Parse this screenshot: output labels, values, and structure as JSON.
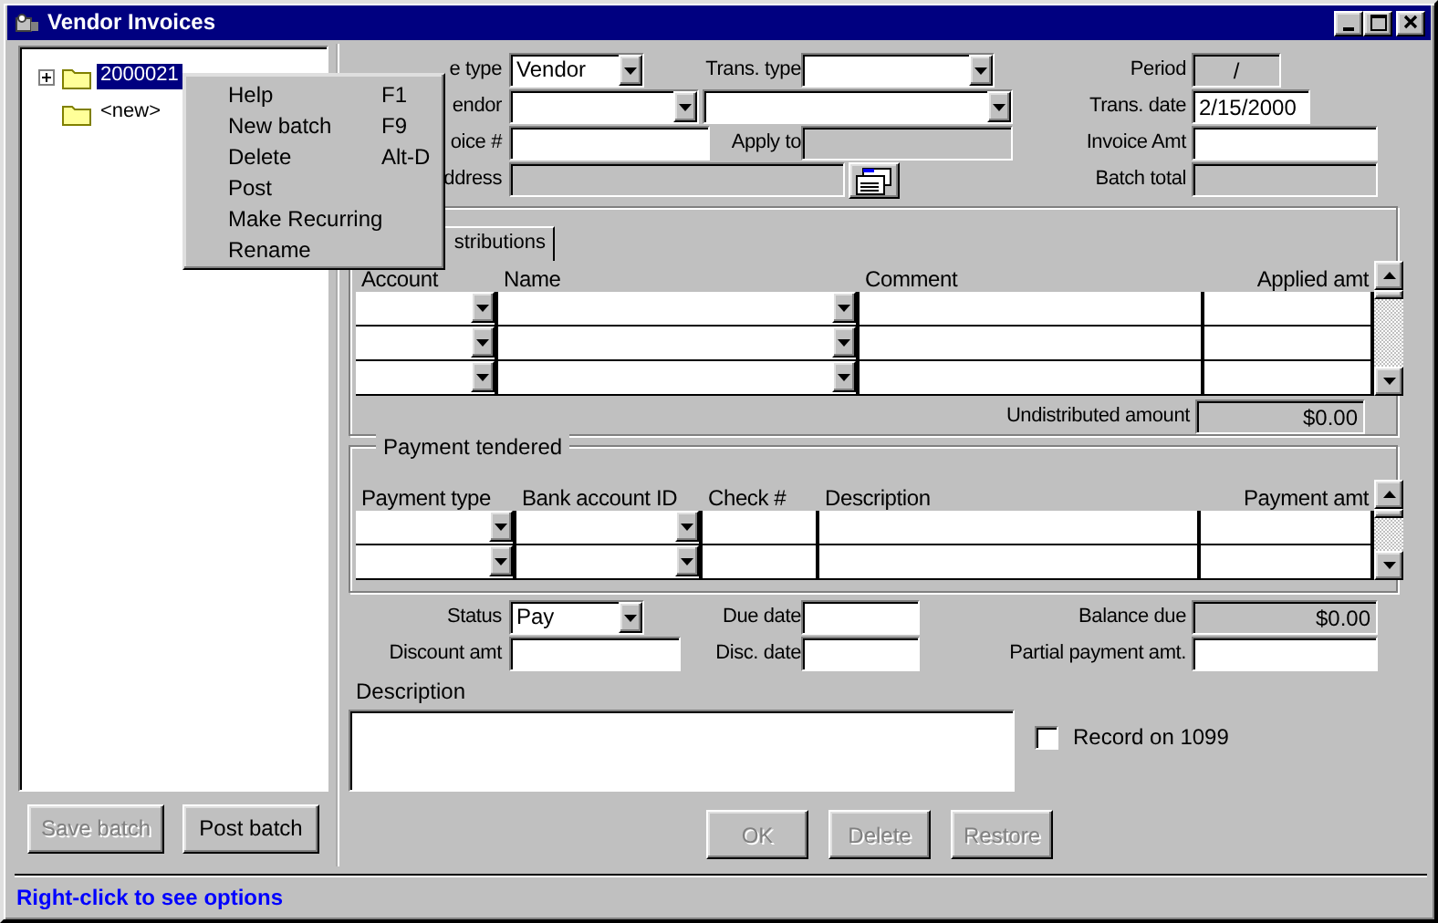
{
  "window": {
    "title": "Vendor Invoices"
  },
  "tree": [
    {
      "label": "2000021",
      "kind": "collapsed",
      "selected": true
    },
    {
      "label": "<new>",
      "kind": "leaf",
      "selected": false
    }
  ],
  "context_menu": [
    {
      "label": "Help",
      "shortcut": "F1"
    },
    {
      "label": "New batch",
      "shortcut": "F9"
    },
    {
      "label": "Delete",
      "shortcut": "Alt-D"
    },
    {
      "label": "Post"
    },
    {
      "label": "Make Recurring"
    },
    {
      "label": "Rename"
    }
  ],
  "batch_buttons": [
    {
      "label": "Save batch",
      "disabled": true
    },
    {
      "label": "Post batch",
      "disabled": false
    }
  ],
  "header_rows": [
    [
      {
        "label": "e type",
        "kind": "combo",
        "value": "Vendor"
      },
      {
        "label": "Trans. type",
        "kind": "combo"
      },
      {
        "label": "Period",
        "kind": "readonly",
        "value": "/"
      }
    ],
    [
      {
        "label": "endor",
        "kind": "combo"
      },
      {
        "kind": "combo"
      },
      {
        "label": "Trans. date",
        "kind": "text",
        "value": "2/15/2000"
      }
    ],
    [
      {
        "label": "oice #",
        "kind": "text"
      },
      {
        "label": "Apply to",
        "kind": "readonly"
      },
      {
        "label": "Invoice Amt",
        "kind": "text"
      }
    ],
    [
      {
        "label": "ddress",
        "kind": "readonly"
      },
      {
        "kind": "lookup"
      },
      {
        "label": "Batch total",
        "kind": "readonly"
      }
    ]
  ],
  "distributions": {
    "tab": {
      "label": "stributions",
      "selected": true
    },
    "columns": [
      {
        "label": "Account",
        "kind": "combo"
      },
      {
        "label": "Name",
        "kind": "combo"
      },
      {
        "label": "Comment",
        "kind": "text"
      },
      {
        "label": "Applied amt",
        "kind": "text"
      }
    ],
    "total": {
      "label": "Undistributed amount",
      "value": "$0.00"
    }
  },
  "payment": {
    "title": "Payment tendered",
    "columns": [
      {
        "label": "Payment type",
        "kind": "combo"
      },
      {
        "label": "Bank account ID",
        "kind": "combo"
      },
      {
        "label": "Check #",
        "kind": "text"
      },
      {
        "label": "Description",
        "kind": "text"
      },
      {
        "label": "Payment amt",
        "kind": "text"
      }
    ]
  },
  "footer_rows": [
    [
      {
        "label": "Status",
        "kind": "combo",
        "value": "Pay"
      },
      {
        "label": "Due date",
        "kind": "text"
      },
      {
        "label": "Balance due",
        "kind": "amount",
        "value": "$0.00"
      }
    ],
    [
      {
        "label": "Discount amt",
        "kind": "text"
      },
      {
        "label": "Disc. date",
        "kind": "text"
      },
      {
        "label": "Partial payment amt.",
        "kind": "text"
      }
    ]
  ],
  "description": {
    "label": "Description"
  },
  "record_1099": {
    "label": "Record on 1099",
    "checked": false
  },
  "action_buttons": [
    {
      "label": "OK",
      "disabled": true
    },
    {
      "label": "Delete",
      "disabled": true
    },
    {
      "label": "Restore",
      "disabled": true
    }
  ],
  "status_bar": "Right-click to see options"
}
